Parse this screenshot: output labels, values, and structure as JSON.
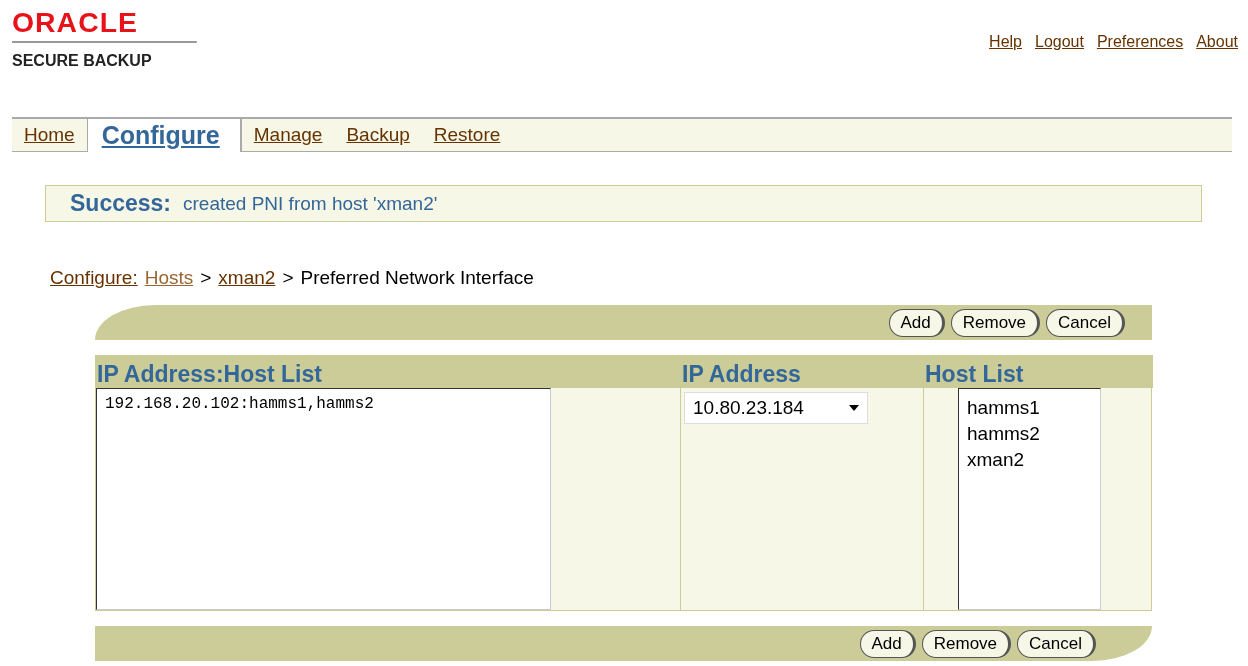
{
  "logo": {
    "brand": "ORACLE",
    "product": "SECURE BACKUP"
  },
  "global_links": [
    "Help",
    "Logout",
    "Preferences",
    "About"
  ],
  "tabs": [
    {
      "label": "Home",
      "selected": false
    },
    {
      "label": "Configure",
      "selected": true
    },
    {
      "label": "Manage",
      "selected": false
    },
    {
      "label": "Backup",
      "selected": false
    },
    {
      "label": "Restore",
      "selected": false
    }
  ],
  "message": {
    "title": "Success:",
    "text": "created PNI from host 'xman2'"
  },
  "breadcrumb": [
    {
      "label": "Configure:",
      "kind": "link"
    },
    {
      "label": "Hosts",
      "kind": "link"
    },
    {
      "label": ">",
      "kind": "separator"
    },
    {
      "label": "xman2",
      "kind": "link"
    },
    {
      "label": ">",
      "kind": "separator"
    },
    {
      "label": "Preferred Network Interface",
      "kind": "current"
    }
  ],
  "top_buttons": [
    "Add",
    "Remove",
    "Cancel"
  ],
  "columns": [
    "IP Address:Host List",
    "IP Address",
    "Host List"
  ],
  "pni_list": [
    {
      "label": "192.168.20.102:hamms1,hamms2",
      "selected": false
    }
  ],
  "ip_address": {
    "value": "10.80.23.184"
  },
  "host_list": [
    {
      "label": "hamms1",
      "selected": false
    },
    {
      "label": "hamms2",
      "selected": false
    },
    {
      "label": "xman2",
      "selected": false
    }
  ],
  "bottom_buttons": [
    "Add",
    "Remove",
    "Cancel"
  ]
}
